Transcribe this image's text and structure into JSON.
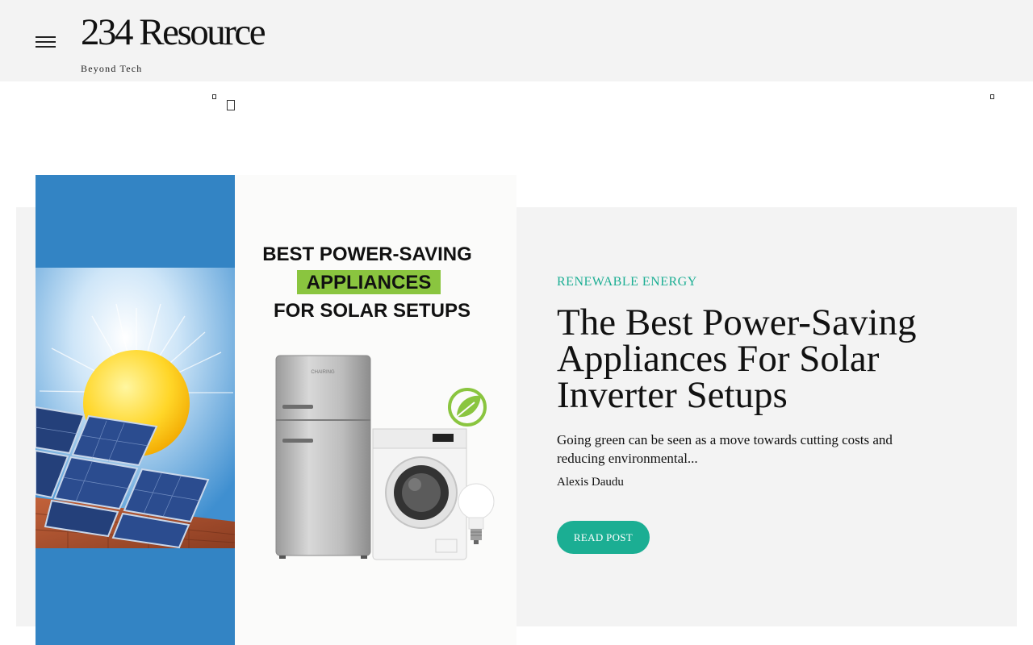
{
  "site": {
    "title": "234 Resource",
    "tagline": "Beyond Tech"
  },
  "hero": {
    "image": {
      "headline_line1": "BEST POWER-SAVING",
      "headline_highlight": "APPLIANCES",
      "headline_line3": "FOR SOLAR SETUPS",
      "fridge_brand": "CHAIRING"
    },
    "category": "Renewable Energy",
    "title": "The Best Power-Saving Appliances For Solar Inverter Setups",
    "excerpt": "Going green can be seen as a move towards cutting costs and reducing environmental...",
    "author": "Alexis Daudu",
    "cta_label": "Read Post"
  },
  "colors": {
    "accent": "#1bae93",
    "header_bg": "#f3f3f3",
    "panel_bg": "#f3f3f3",
    "sky_blue": "#3384c4",
    "highlight_green": "#8ac53f"
  },
  "icons": {
    "menu": "hamburger-menu-icon",
    "search": "search-icon",
    "eco": "leaf-icon"
  }
}
